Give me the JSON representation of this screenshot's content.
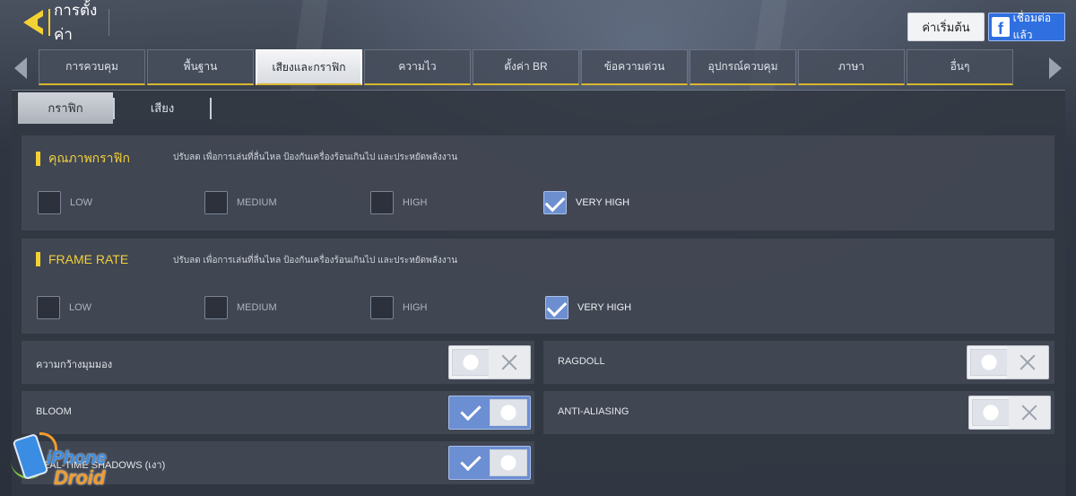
{
  "header": {
    "title": "การตั้งค่า",
    "reset_label": "ค่าเริ่มต้น",
    "facebook_label": "เชื่อมต่อแล้ว",
    "facebook_glyph": "f"
  },
  "tabs": [
    {
      "label": "การควบคุม",
      "active": false
    },
    {
      "label": "พื้นฐาน",
      "active": false
    },
    {
      "label": "เสียงและกราฟิก",
      "active": true
    },
    {
      "label": "ความไว",
      "active": false
    },
    {
      "label": "ตั้งค่า BR",
      "active": false
    },
    {
      "label": "ข้อความด่วน",
      "active": false
    },
    {
      "label": "อุปกรณ์ควบคุม",
      "active": false
    },
    {
      "label": "ภาษา",
      "active": false
    },
    {
      "label": "อื่นๆ",
      "active": false
    }
  ],
  "subtabs": [
    {
      "label": "กราฟิก",
      "active": true
    },
    {
      "label": "เสียง",
      "active": false
    }
  ],
  "graphics_quality": {
    "title": "คุณภาพกราฟิก",
    "description": "ปรับลด เพื่อการเล่นที่ลื่นไหล ป้องกันเครื่องร้อนเกินไป และประหยัดพลังงาน",
    "options": [
      "LOW",
      "MEDIUM",
      "HIGH",
      "VERY HIGH"
    ],
    "selected": "VERY HIGH"
  },
  "frame_rate": {
    "title": "FRAME RATE",
    "description": "ปรับลด เพื่อการเล่นที่ลื่นไหล ป้องกันเครื่องร้อนเกินไป และประหยัดพลังงาน",
    "options": [
      "LOW",
      "MEDIUM",
      "HIGH",
      "VERY HIGH"
    ],
    "selected": "VERY HIGH"
  },
  "toggles": [
    {
      "label": "ความกว้างมุมมอง",
      "enabled": false
    },
    {
      "label": "RAGDOLL",
      "enabled": false
    },
    {
      "label": "BLOOM",
      "enabled": true
    },
    {
      "label": "ANTI-ALIASING",
      "enabled": false
    },
    {
      "label": "REAL-TIME SHADOWS (เงา)",
      "enabled": true
    }
  ],
  "watermark": {
    "line1": "iPhone",
    "line2": "Droid"
  },
  "colors": {
    "accent_yellow": "#f4d234",
    "toggle_on": "#6c8ed2",
    "facebook_blue": "#2f6fe0"
  }
}
